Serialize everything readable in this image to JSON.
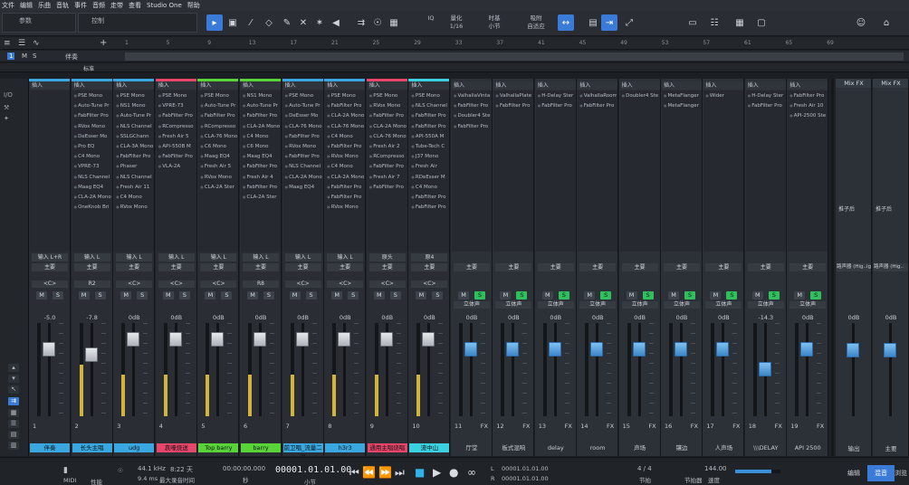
{
  "menu": [
    "文件",
    "编辑",
    "乐曲",
    "音轨",
    "事件",
    "音频",
    "走带",
    "查看",
    "Studio One",
    "帮助"
  ],
  "toolbar": {
    "param_label": "参数",
    "control_label": "控制",
    "quantize_label": "量化",
    "quantize_value": "1/16",
    "timebase_label": "时基",
    "timebase_value": "小节",
    "snap_label": "吸附",
    "snap_value": "自适应",
    "iq_label": "IQ"
  },
  "ruler_ticks": [
    "1",
    "5",
    "9",
    "13",
    "17",
    "21",
    "25",
    "29",
    "33",
    "37",
    "41",
    "45",
    "49",
    "53",
    "57",
    "61",
    "65",
    "69"
  ],
  "track_header": {
    "number": "1",
    "m": "M",
    "s": "S",
    "name": "伴奏",
    "sub_label": "标准"
  },
  "left_strip": {
    "io": "I/O",
    "labels": [
      "I/O"
    ]
  },
  "channels": [
    {
      "input": "输入 L+R",
      "main": "主要",
      "pan": "<C>",
      "gain": "-5.0",
      "num": "1",
      "name": "伴奏",
      "color": "#39a8e0",
      "fader": 0.8,
      "meter": 0.0,
      "blue": false,
      "green_s": false,
      "mode": "",
      "plugins": []
    },
    {
      "input": "输入 L",
      "main": "主要",
      "pan": "R2",
      "gain": "-7.8",
      "num": "2",
      "name": "长头主唱",
      "color": "#39a8e0",
      "fader": 0.74,
      "meter": 0.55,
      "blue": false,
      "green_s": false,
      "mode": "",
      "plugins": [
        "PSE Mono",
        "Auto-Tune Pr",
        "FabFilter Pro",
        "RVox Mono",
        "DeEsser Mo",
        "Pro EQ",
        "C4 Mono",
        "VPRE-73",
        "NLS Channel",
        "Maag EQ4",
        "CLA-2A Mono",
        "OneKnob Bri"
      ]
    },
    {
      "input": "输入 L",
      "main": "主要",
      "pan": "<C>",
      "gain": "0dB",
      "num": "3",
      "name": "udg",
      "color": "#39a8e0",
      "fader": 0.9,
      "meter": 0.45,
      "blue": false,
      "green_s": false,
      "mode": "",
      "plugins": [
        "PSE Mono",
        "NS1 Mono",
        "Auto-Tune Pr",
        "NLS Channel",
        "SSLGChann",
        "CLA-3A Mono",
        "FabFilter Pro",
        "Phaser",
        "NLS Channel",
        "Fresh Air 11",
        "C4 Mono",
        "RVox Mono"
      ]
    },
    {
      "input": "输入 L",
      "main": "主要",
      "pan": "<C>",
      "gain": "0dB",
      "num": "4",
      "name": "哀嚎烧送",
      "color": "#e8456a",
      "fader": 0.9,
      "meter": 0.45,
      "blue": false,
      "green_s": false,
      "mode": "",
      "plugins": [
        "PSE Mono",
        "VPRE-73",
        "FabFilter Pro",
        "RCompresso",
        "Fresh Air 5",
        "API-550B M",
        "FabFilter Pro",
        "VLA-2A"
      ]
    },
    {
      "input": "输入 L",
      "main": "主要",
      "pan": "<C>",
      "gain": "0dB",
      "num": "5",
      "name": "Top barry",
      "color": "#58d436",
      "fader": 0.9,
      "meter": 0.45,
      "blue": false,
      "green_s": false,
      "mode": "",
      "plugins": [
        "PSE Mono",
        "Auto-Tune Pr",
        "FabFilter Pro",
        "RCompresso",
        "CLA-76 Mono",
        "C6 Mono",
        "Maag EQ4",
        "Fresh Air 5",
        "RVox Mono",
        "CLA-2A Ster"
      ]
    },
    {
      "input": "输入 L",
      "main": "主要",
      "pan": "R8",
      "gain": "0dB",
      "num": "6",
      "name": "barry",
      "color": "#58d436",
      "fader": 0.9,
      "meter": 0.45,
      "blue": false,
      "green_s": false,
      "mode": "",
      "plugins": [
        "NS1 Mono",
        "Auto-Tune Pr",
        "FabFilter Pro",
        "CLA-2A Mono",
        "C4 Mono",
        "C6 Mono",
        "Maag EQ4",
        "FabFilter Pro",
        "Fresh Air 4",
        "FabFilter Pro",
        "CLA-2A Ster"
      ]
    },
    {
      "input": "输入 L",
      "main": "主要",
      "pan": "<C>",
      "gain": "0dB",
      "num": "7",
      "name": "前卫唱_流量二混",
      "color": "#39a8e0",
      "fader": 0.9,
      "meter": 0.45,
      "blue": false,
      "green_s": false,
      "mode": "",
      "plugins": [
        "PSE Mono",
        "Auto-Tune Pr",
        "DeEsser Mo",
        "CLA-76 Mono",
        "FabFilter Pro",
        "RVox Mono",
        "FabFilter Pro",
        "NLS Channel",
        "CLA-2A Mono",
        "Maag EQ4"
      ]
    },
    {
      "input": "输入 L",
      "main": "主要",
      "pan": "<C>",
      "gain": "0dB",
      "num": "8",
      "name": "h3r3",
      "color": "#39a8e0",
      "fader": 0.9,
      "meter": 0.45,
      "blue": false,
      "green_s": false,
      "mode": "",
      "plugins": [
        "PSE Mono",
        "FabFilter Pro",
        "CLA-2A Mono",
        "CLA-76 Mono",
        "C4 Mono",
        "FabFilter Pro",
        "RVox Mono",
        "C4 Mono",
        "CLA-2A Mono",
        "FabFilter Pro",
        "FabFilter Pro",
        "RVox Mono"
      ]
    },
    {
      "input": "原头",
      "main": "主要",
      "pan": "<C>",
      "gain": "0dB",
      "num": "9",
      "name": "通用主唱烧唱",
      "color": "#e8456a",
      "fader": 0.9,
      "meter": 0.45,
      "blue": false,
      "green_s": false,
      "mode": "",
      "plugins": [
        "PSE Mono",
        "RVox Mono",
        "FabFilter Pro",
        "CLA-2A Mono",
        "CLA-76 Mono",
        "Fresh Air 2",
        "RCompresso",
        "FabFilter Pro",
        "Fresh Air 7",
        "FabFilter Pro"
      ]
    },
    {
      "input": "原4",
      "main": "主要",
      "pan": "<C>",
      "gain": "0dB",
      "num": "10",
      "name": "流中山",
      "color": "#3ad2e0",
      "fader": 0.9,
      "meter": 0.45,
      "blue": false,
      "green_s": false,
      "mode": "",
      "plugins": [
        "PSE Mono",
        "NLS Channel",
        "FabFilter Pro",
        "FabFilter Pro",
        "API-550A M",
        "Tube-Tech C",
        "J37 Mono",
        "Fresh Air",
        "RDeEsser M",
        "C4 Mono",
        "FabFilter Pro",
        "FabFilter Pro"
      ]
    }
  ],
  "buses": [
    {
      "main": "主要",
      "pan": "立体声",
      "gain": "0dB",
      "num": "11",
      "name": "厅堂",
      "fader": 0.8,
      "plugins": [
        "ValhallaVinta",
        "FabFilter Pro",
        "Doubler4 Ste",
        "FabFilter Pro"
      ]
    },
    {
      "main": "主要",
      "pan": "立体声",
      "gain": "0dB",
      "num": "12",
      "name": "板式混响",
      "fader": 0.8,
      "plugins": [
        "ValhallaPlate",
        "FabFilter Pro"
      ]
    },
    {
      "main": "主要",
      "pan": "立体声",
      "gain": "0dB",
      "num": "13",
      "name": "delay",
      "fader": 0.8,
      "plugins": [
        "H-Delay Ster",
        "FabFilter Pro"
      ]
    },
    {
      "main": "主要",
      "pan": "立体声",
      "gain": "0dB",
      "num": "14",
      "name": "room",
      "fader": 0.8,
      "plugins": [
        "ValhallaRoom",
        "FabFilter Pro"
      ]
    },
    {
      "main": "主要",
      "pan": "立体声",
      "gain": "0dB",
      "num": "15",
      "name": "声场",
      "fader": 0.8,
      "plugins": [
        "Doubler4 Ste"
      ]
    },
    {
      "main": "主要",
      "pan": "立体声",
      "gain": "0dB",
      "num": "16",
      "name": "镶边",
      "fader": 0.8,
      "plugins": [
        "MetaFlanger",
        "MetaFlanger"
      ]
    },
    {
      "main": "主要",
      "pan": "立体声",
      "gain": "0dB",
      "num": "17",
      "name": "人声场",
      "fader": 0.8,
      "plugins": [
        "Wider"
      ]
    },
    {
      "main": "主要",
      "pan": "立体声",
      "gain": "-14.3",
      "num": "18",
      "name": "\\\\\\DELAY",
      "fader": 0.58,
      "plugins": [
        "H-Delay Ster",
        "FabFilter Pro"
      ]
    },
    {
      "main": "主要",
      "pan": "立体声",
      "gain": "0dB",
      "num": "19",
      "name": "API 2500",
      "fader": 0.8,
      "plugins": [
        "FabFilter Pro",
        "Fresh Air 10",
        "API-2500 Ste"
      ]
    }
  ],
  "fx_channels": [
    {
      "head": "Mix FX",
      "sub": "推子后",
      "sel": "路声器 (Hig..ight",
      "gain": "0dB",
      "name": "输出"
    },
    {
      "head": "Mix FX",
      "sub": "推子后",
      "sel": "路声器 (Hig..",
      "gain": "0dB",
      "name": "主要"
    }
  ],
  "insert_label": "插入",
  "m_label": "M",
  "s_label": "S",
  "fx_label": "FX",
  "transport": {
    "midi_label": "MIDI",
    "perf_label": "性能",
    "sample_rate": "44.1 kHz",
    "latency": "9.4 ms",
    "days": "8:22 天",
    "record_time_label": "最大录音时间",
    "time": "00:00:00.000",
    "time_unit": "秒",
    "bars": "00001.01.01.00",
    "bars_unit": "小节",
    "l_pos": "00001.01.01.00",
    "r_pos": "00001.01.01.00",
    "l": "L",
    "r": "R",
    "sig": "4 / 4",
    "sig_label": "节拍",
    "key_label": "节拍器",
    "tempo": "144.00",
    "tempo_label": "速度",
    "edit_label": "编辑",
    "mix_label": "混音",
    "browse_label": "浏览"
  }
}
